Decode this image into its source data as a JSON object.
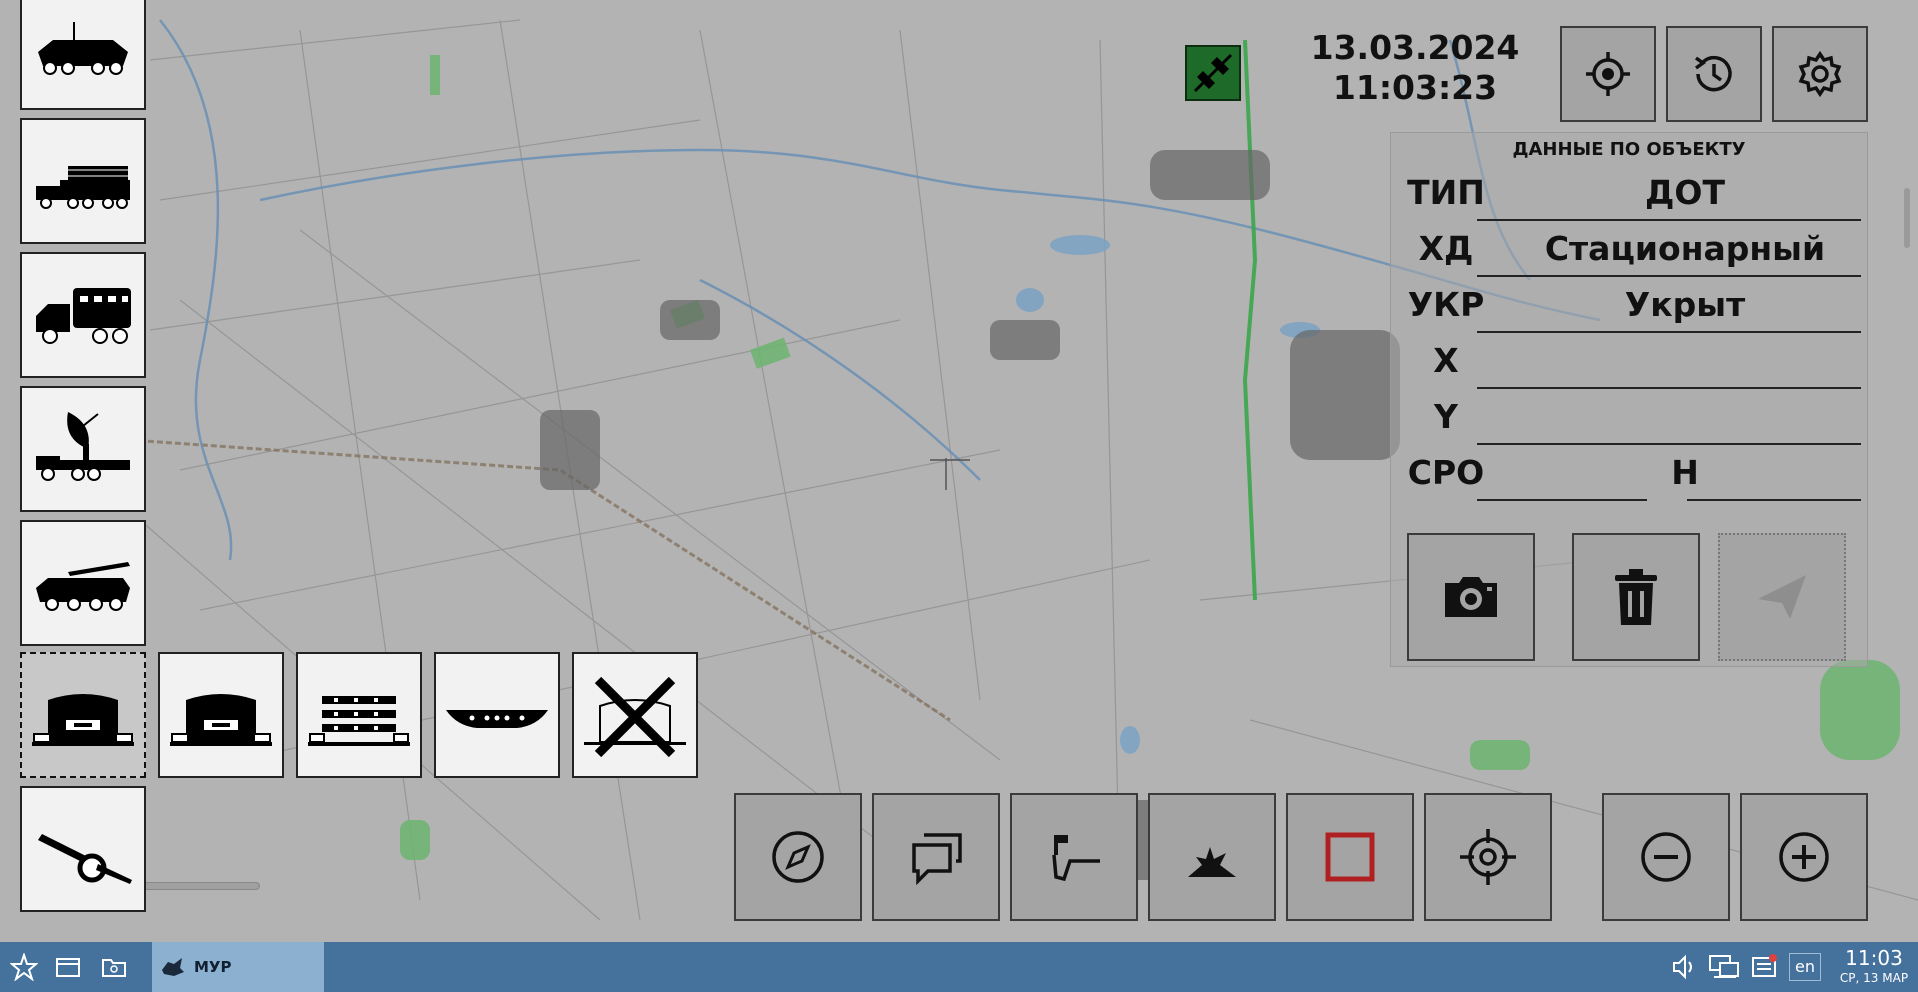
{
  "datetime": {
    "date": "13.03.2024",
    "time": "11:03:23"
  },
  "icons": {
    "connection": "plug-connected-icon",
    "center_location": "crosshair-location-icon",
    "history": "history-clock-icon",
    "settings": "gear-icon"
  },
  "panel": {
    "title": "ДАННЫЕ ПО ОБЪЕКТУ",
    "rows": [
      {
        "label": "ТИП",
        "value": "ДОТ"
      },
      {
        "label": "ХД",
        "value": "Стационарный"
      },
      {
        "label": "УКР",
        "value": "Укрыт"
      },
      {
        "label": "X",
        "value": ""
      },
      {
        "label": "Y",
        "value": ""
      },
      {
        "label": "СРО",
        "value": "Н"
      }
    ]
  },
  "tools": [
    {
      "name": "apc-tool",
      "icon": "armored-vehicle-icon"
    },
    {
      "name": "mlrs-tool",
      "icon": "rocket-launcher-truck-icon"
    },
    {
      "name": "truck-tool",
      "icon": "command-truck-icon"
    },
    {
      "name": "radar-tool",
      "icon": "radar-truck-icon"
    },
    {
      "name": "missile-tool",
      "icon": "missile-carrier-icon"
    },
    {
      "name": "artillery-tool",
      "icon": "howitzer-icon"
    }
  ],
  "subtools": [
    {
      "name": "bunker-selected-tool",
      "icon": "bunker-icon",
      "selected": true
    },
    {
      "name": "bunker-tool",
      "icon": "bunker-icon",
      "selected": false
    },
    {
      "name": "fortification-tool",
      "icon": "fortification-icon",
      "selected": false
    },
    {
      "name": "trench-tool",
      "icon": "trench-icon",
      "selected": false
    },
    {
      "name": "destroyed-tool",
      "icon": "destroyed-object-icon",
      "selected": false
    }
  ],
  "bottom_toolbar": [
    "compass-icon",
    "chat-icon",
    "flag-marker-icon",
    "explosion-icon",
    "square-icon",
    "target-icon",
    "zoom-out-icon",
    "zoom-in-icon"
  ],
  "colors": {
    "map": "#b3b3b3",
    "taskbar": "#44729c",
    "taskbar_app": "#8cb0d0",
    "connection": "#1e6b29",
    "square_accent": "#b02020"
  },
  "taskbar": {
    "app_label": "МУР",
    "lang": "en",
    "time": "11:03",
    "date": "СР, 13 МАР"
  }
}
